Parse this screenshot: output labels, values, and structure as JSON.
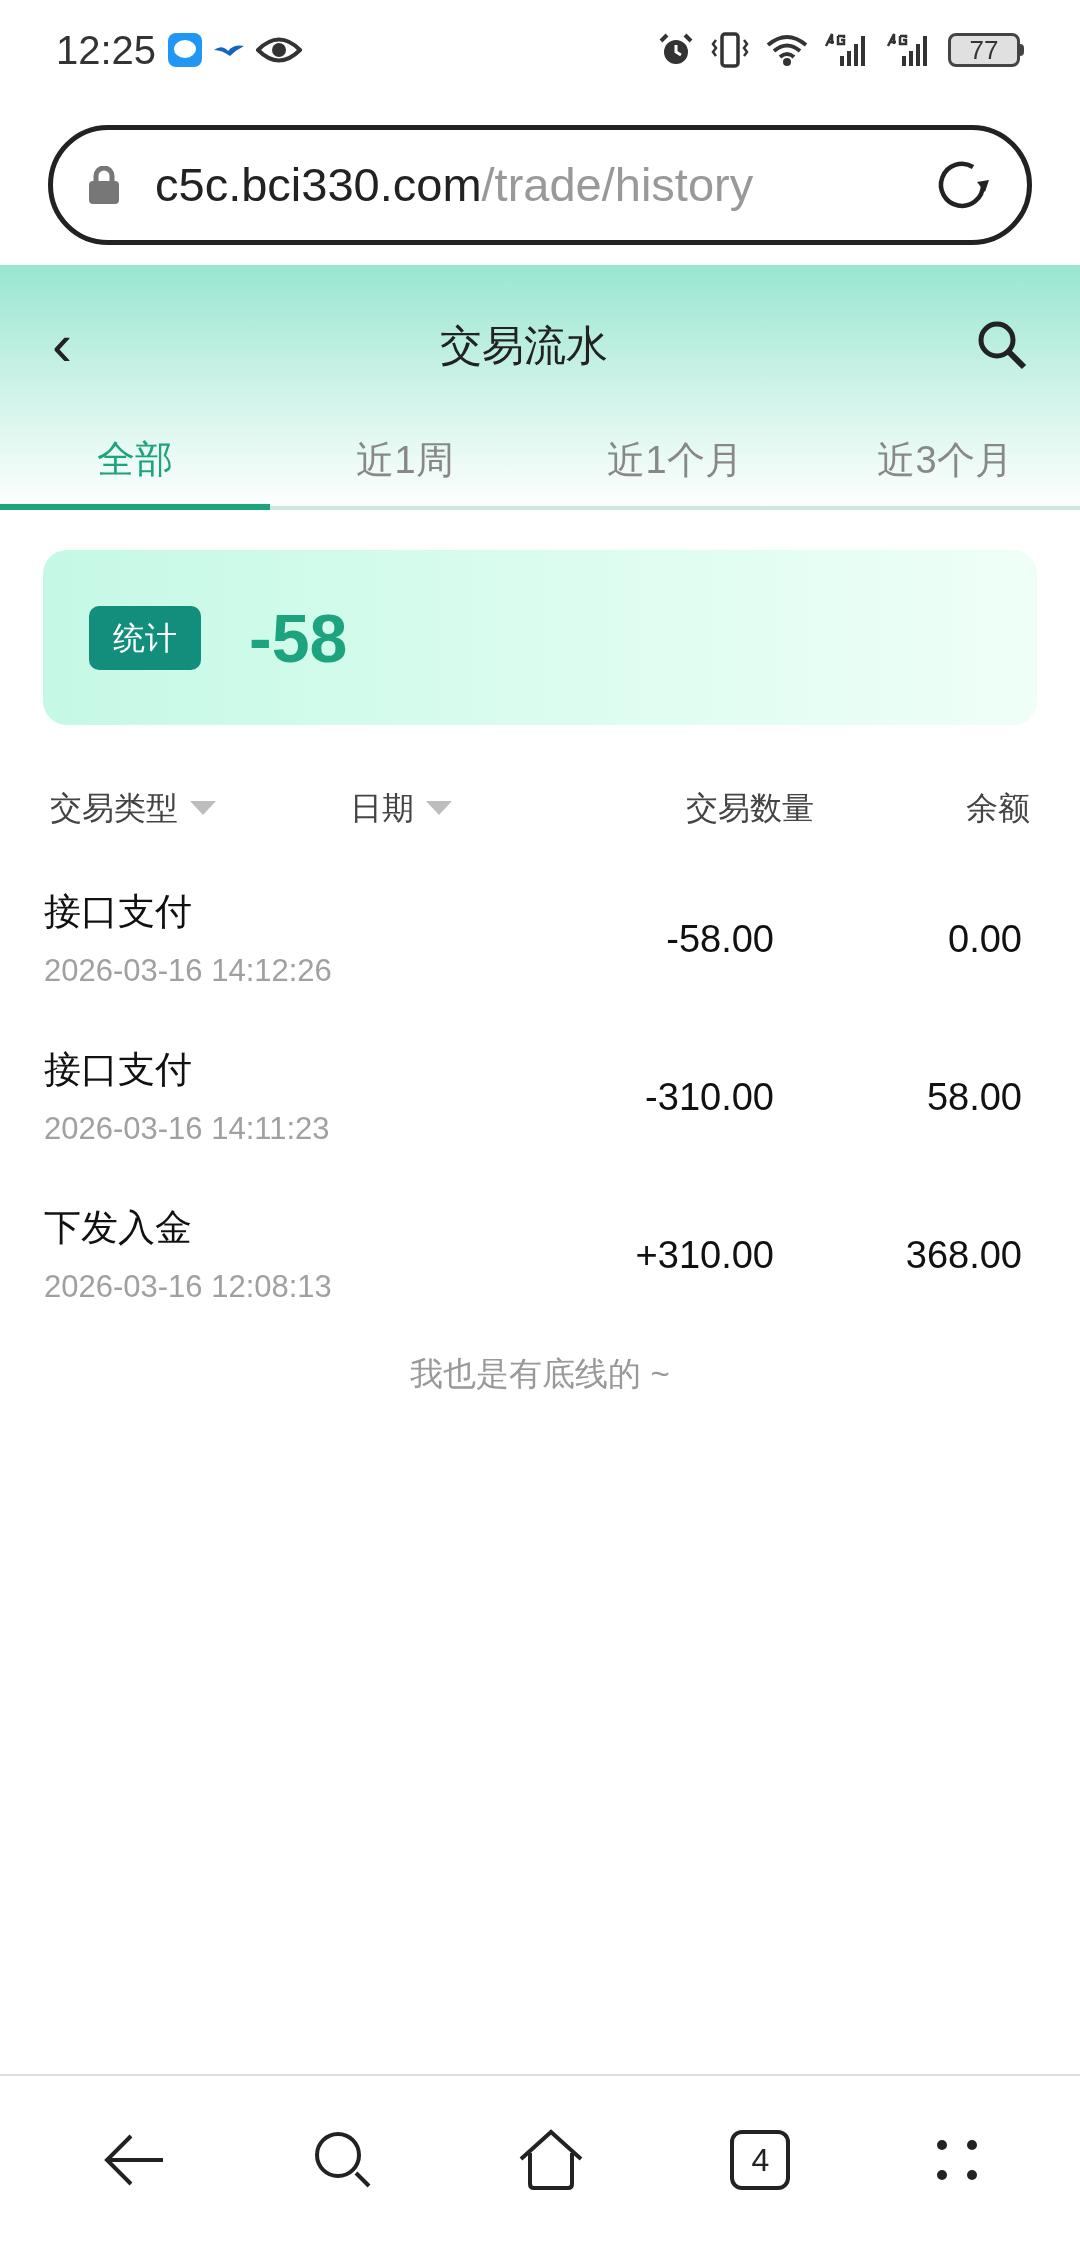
{
  "status_bar": {
    "time": "12:25",
    "battery": "77"
  },
  "address_bar": {
    "domain": "c5c.bci330.com",
    "path": "/trade/history"
  },
  "header": {
    "back": "‹",
    "title": "交易流水"
  },
  "tabs": [
    {
      "label": "全部",
      "selected": true
    },
    {
      "label": "近1周",
      "selected": false
    },
    {
      "label": "近1个月",
      "selected": false
    },
    {
      "label": "近3个月",
      "selected": false
    }
  ],
  "summary": {
    "badge": "统计",
    "total": "-58"
  },
  "table": {
    "columns": [
      "交易类型",
      "日期",
      "交易数量",
      "余额"
    ],
    "rows": [
      {
        "type": "接口支付",
        "date": "2026-03-16 14:12:26",
        "amount": "-58.00",
        "balance": "0.00"
      },
      {
        "type": "接口支付",
        "date": "2026-03-16 14:11:23",
        "amount": "-310.00",
        "balance": "58.00"
      },
      {
        "type": "下发入金",
        "date": "2026-03-16 12:08:13",
        "amount": "+310.00",
        "balance": "368.00"
      }
    ]
  },
  "end_note": "我也是有底线的 ~",
  "bottom_nav": {
    "tab_count": "4"
  }
}
